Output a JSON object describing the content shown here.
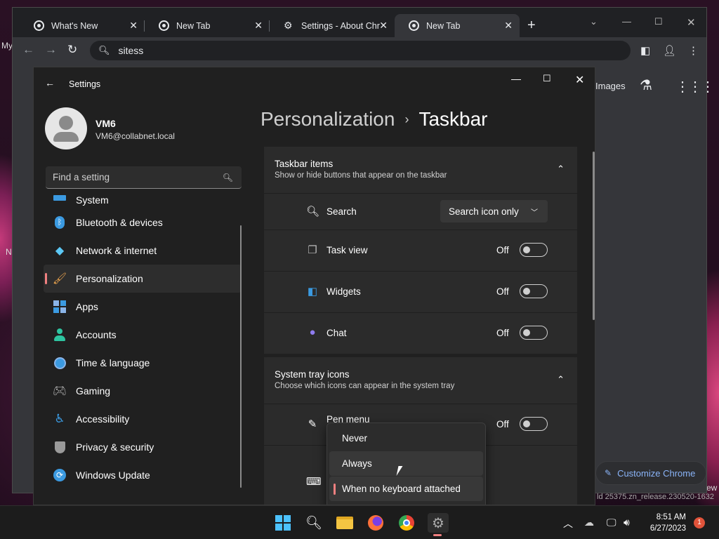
{
  "desktop": {
    "frag_top": "My",
    "frag_mid": "N",
    "frag_bottom_right": "ew"
  },
  "browser": {
    "tabs": [
      {
        "label": "What's New",
        "icon": "chrome-icon"
      },
      {
        "label": "New Tab",
        "icon": "chrome-icon"
      },
      {
        "label": "Settings - About Chr",
        "icon": "gear-icon"
      },
      {
        "label": "New Tab",
        "icon": "chrome-icon",
        "active": true
      }
    ],
    "address": "sitess",
    "ntp": {
      "images_label": "Images",
      "customize_label": "Customize Chrome",
      "build_text": "ld 25375.zn_release.230520-1632"
    }
  },
  "settings": {
    "window_title": "Settings",
    "user": {
      "name": "VM6",
      "email": "VM6@collabnet.local"
    },
    "search_placeholder": "Find a setting",
    "nav": [
      {
        "label": "System",
        "icon": "system-icon",
        "color": "#3b9ae1"
      },
      {
        "label": "Bluetooth & devices",
        "icon": "bluetooth-icon",
        "color": "#3b9ae1"
      },
      {
        "label": "Network & internet",
        "icon": "wifi-icon",
        "color": "#5cc8f5"
      },
      {
        "label": "Personalization",
        "icon": "brush-icon",
        "color": "#e8a24d",
        "selected": true
      },
      {
        "label": "Apps",
        "icon": "apps-icon",
        "color": "#8ab4e8"
      },
      {
        "label": "Accounts",
        "icon": "accounts-icon",
        "color": "#2ec4a0"
      },
      {
        "label": "Time & language",
        "icon": "clock-globe-icon",
        "color": "#3b9ae1"
      },
      {
        "label": "Gaming",
        "icon": "gamepad-icon",
        "color": "#bbbbbb"
      },
      {
        "label": "Accessibility",
        "icon": "accessibility-icon",
        "color": "#3b9ae1"
      },
      {
        "label": "Privacy & security",
        "icon": "shield-icon",
        "color": "#aaaaaa"
      },
      {
        "label": "Windows Update",
        "icon": "update-icon",
        "color": "#3b9ae1"
      }
    ],
    "breadcrumb": {
      "parent": "Personalization",
      "separator": "›",
      "current": "Taskbar"
    },
    "taskbar_items": {
      "title": "Taskbar items",
      "subtitle": "Show or hide buttons that appear on the taskbar",
      "rows": [
        {
          "label": "Search",
          "control": "dropdown",
          "value": "Search icon only"
        },
        {
          "label": "Task view",
          "control": "toggle",
          "value": "Off"
        },
        {
          "label": "Widgets",
          "control": "toggle",
          "value": "Off"
        },
        {
          "label": "Chat",
          "control": "toggle",
          "value": "Off"
        }
      ]
    },
    "system_tray": {
      "title": "System tray icons",
      "subtitle": "Choose which icons can appear in the system tray",
      "rows": [
        {
          "label": "Pen menu",
          "control": "toggle",
          "value": "Off"
        }
      ]
    },
    "popup_options": [
      "Never",
      "Always",
      "When no keyboard attached"
    ],
    "popup_selected": "When no keyboard attached",
    "popup_hovered": "Always"
  },
  "taskbar": {
    "apps": [
      "start-icon",
      "search-icon",
      "file-explorer-icon",
      "firefox-icon",
      "chrome-icon",
      "settings-icon"
    ],
    "time": "8:51 AM",
    "date": "6/27/2023",
    "notification_count": "1"
  },
  "colors": {
    "accent": "#f08080",
    "link": "#8ab4f8"
  }
}
